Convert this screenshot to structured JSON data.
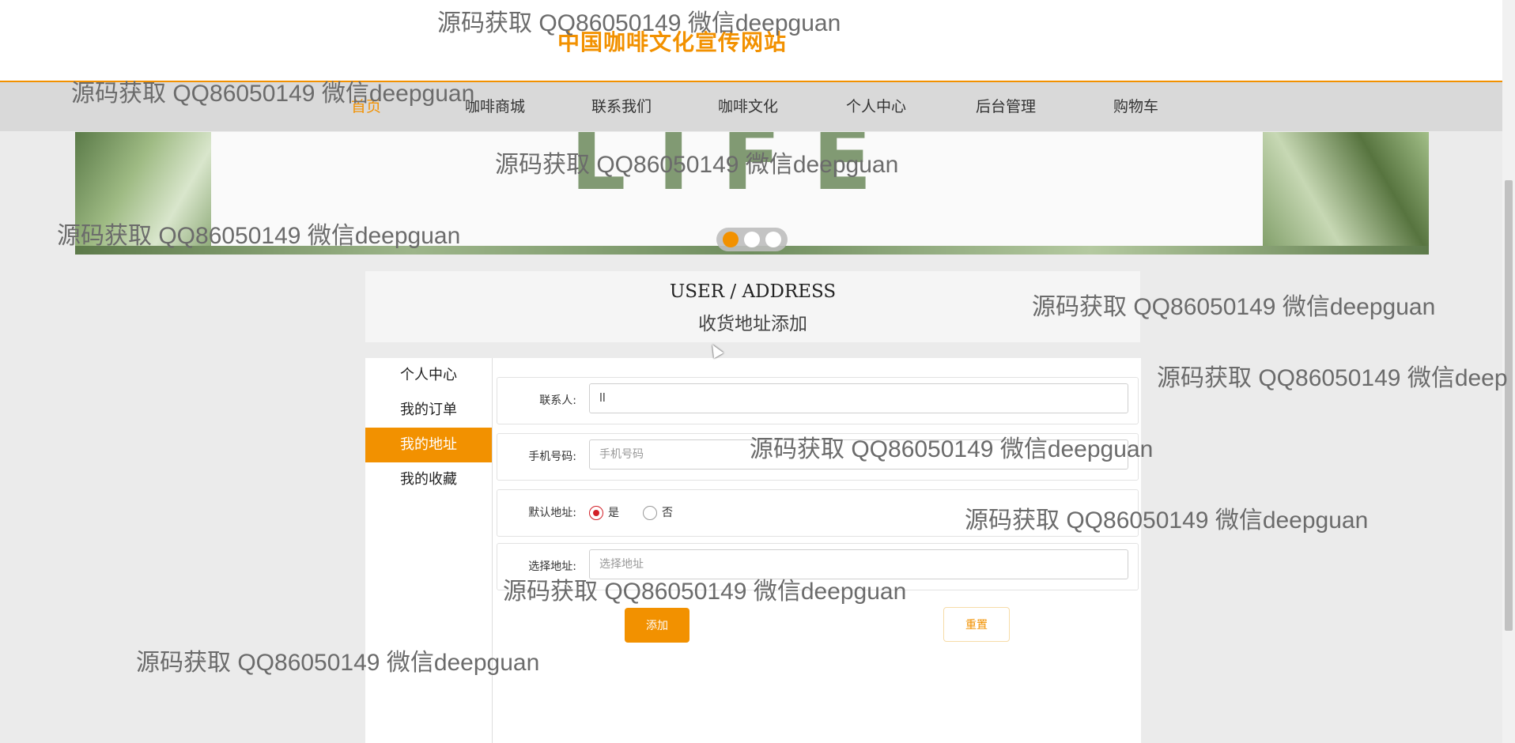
{
  "header": {
    "site_title": "中国咖啡文化宣传网站"
  },
  "nav": {
    "items": [
      {
        "label": "首页",
        "active": true
      },
      {
        "label": "咖啡商城",
        "active": false
      },
      {
        "label": "联系我们",
        "active": false
      },
      {
        "label": "咖啡文化",
        "active": false
      },
      {
        "label": "个人中心",
        "active": false
      },
      {
        "label": "后台管理",
        "active": false
      },
      {
        "label": "购物车",
        "active": false
      }
    ]
  },
  "banner": {
    "word": "LIFE",
    "slide_count": 3,
    "active_slide": 1
  },
  "section": {
    "title_en": "USER / ADDRESS",
    "title_cn": "收货地址添加"
  },
  "sidebar": {
    "items": [
      {
        "label": "个人中心",
        "active": false
      },
      {
        "label": "我的订单",
        "active": false
      },
      {
        "label": "我的地址",
        "active": true
      },
      {
        "label": "我的收藏",
        "active": false
      }
    ]
  },
  "form": {
    "contact": {
      "label": "联系人:",
      "value": "ll",
      "placeholder": ""
    },
    "phone": {
      "label": "手机号码:",
      "value": "",
      "placeholder": "手机号码"
    },
    "default": {
      "label": "默认地址:",
      "yes": "是",
      "no": "否",
      "selected": "是"
    },
    "address": {
      "label": "选择地址:",
      "value": "",
      "placeholder": "选择地址"
    },
    "add_button": "添加",
    "reset_button": "重置"
  },
  "watermarks": {
    "w1": "源码获取 QQ86050149 微信deepguan",
    "w2": "源码获取 QQ86050149 微信deepguan",
    "w3": "源码获取 QQ86050149 微信deepguan",
    "w4": "源码获取 QQ86050149 微信deepguan",
    "w5": "源码获取 QQ86050149 微信deepguan",
    "w6": "源码获取 QQ86050149 微信deep",
    "w7": "源码获取 QQ86050149 微信deepguan",
    "w8": "源码获取 QQ86050149 微信deepguan",
    "w9": "源码获取 QQ86050149 微信deepguan",
    "w10": "源码获取 QQ86050149 微信deepguan"
  },
  "colors": {
    "accent": "#f29100",
    "radio_checked": "#d21f27",
    "nav_bg": "#d9d9d9",
    "page_bg": "#ebebeb"
  }
}
